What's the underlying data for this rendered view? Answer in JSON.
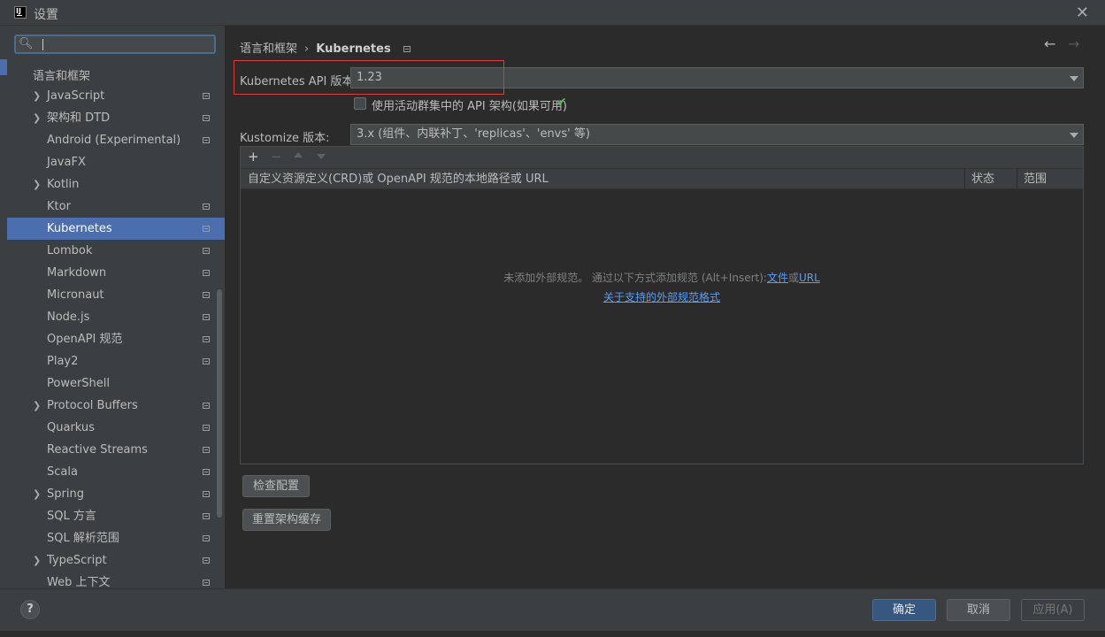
{
  "window": {
    "title": "设置",
    "close_glyph": "✕",
    "logo": "IJ"
  },
  "search": {
    "value": "",
    "placeholder": ""
  },
  "sidebar": {
    "section": "语言和框架",
    "items": [
      {
        "label": "JavaScript",
        "expandable": true,
        "page_icon": true,
        "selected": false
      },
      {
        "label": "架构和 DTD",
        "expandable": true,
        "page_icon": true,
        "selected": false
      },
      {
        "label": "Android (Experimental)",
        "expandable": false,
        "page_icon": true,
        "selected": false
      },
      {
        "label": "JavaFX",
        "expandable": false,
        "page_icon": false,
        "selected": false
      },
      {
        "label": "Kotlin",
        "expandable": true,
        "page_icon": false,
        "selected": false
      },
      {
        "label": "Ktor",
        "expandable": false,
        "page_icon": true,
        "selected": false
      },
      {
        "label": "Kubernetes",
        "expandable": false,
        "page_icon": true,
        "selected": true
      },
      {
        "label": "Lombok",
        "expandable": false,
        "page_icon": true,
        "selected": false
      },
      {
        "label": "Markdown",
        "expandable": false,
        "page_icon": true,
        "selected": false
      },
      {
        "label": "Micronaut",
        "expandable": false,
        "page_icon": true,
        "selected": false
      },
      {
        "label": "Node.js",
        "expandable": false,
        "page_icon": true,
        "selected": false
      },
      {
        "label": "OpenAPI 规范",
        "expandable": false,
        "page_icon": true,
        "selected": false
      },
      {
        "label": "Play2",
        "expandable": false,
        "page_icon": true,
        "selected": false
      },
      {
        "label": "PowerShell",
        "expandable": false,
        "page_icon": false,
        "selected": false
      },
      {
        "label": "Protocol Buffers",
        "expandable": true,
        "page_icon": true,
        "selected": false
      },
      {
        "label": "Quarkus",
        "expandable": false,
        "page_icon": true,
        "selected": false
      },
      {
        "label": "Reactive Streams",
        "expandable": false,
        "page_icon": true,
        "selected": false
      },
      {
        "label": "Scala",
        "expandable": false,
        "page_icon": true,
        "selected": false
      },
      {
        "label": "Spring",
        "expandable": true,
        "page_icon": true,
        "selected": false
      },
      {
        "label": "SQL 方言",
        "expandable": false,
        "page_icon": true,
        "selected": false
      },
      {
        "label": "SQL 解析范围",
        "expandable": false,
        "page_icon": true,
        "selected": false
      },
      {
        "label": "TypeScript",
        "expandable": true,
        "page_icon": true,
        "selected": false
      },
      {
        "label": "Web 上下文",
        "expandable": false,
        "page_icon": true,
        "selected": false
      }
    ]
  },
  "breadcrumb": {
    "parent": "语言和框架",
    "separator": "›",
    "current": "Kubernetes"
  },
  "nav": {
    "back": "←",
    "forward": "→"
  },
  "form": {
    "api_label": "Kubernetes API 版本:",
    "api_value": "1.23",
    "checkbox_label": "使用活动群集中的 API 架构(如果可用)",
    "checkbox_checked": false,
    "kustomize_label": "Kustomize 版本:",
    "kustomize_value": "3.x (组件、内联补丁、'replicas'、'envs' 等)"
  },
  "table": {
    "toolbar": {
      "add": "+",
      "remove": "−"
    },
    "columns": [
      "自定义资源定义(CRD)或 OpenAPI 规范的本地路径或 URL",
      "状态",
      "范围"
    ],
    "empty_text": "未添加外部规范。 通过以下方式添加规范 (Alt+Insert):",
    "link_file": "文件",
    "or": "或",
    "link_url": "URL",
    "link_formats": "关于支持的外部规范格式"
  },
  "buttons": {
    "check_config": "检查配置",
    "reset_cache": "重置架构缓存",
    "ok": "确定",
    "cancel": "取消",
    "apply": "应用(A)",
    "help": "?"
  },
  "colors": {
    "selection": "#4b6eaf",
    "highlight_box": "#e03b3b",
    "link": "#589df6",
    "success": "#5fb85c",
    "primary_button": "#365880"
  }
}
